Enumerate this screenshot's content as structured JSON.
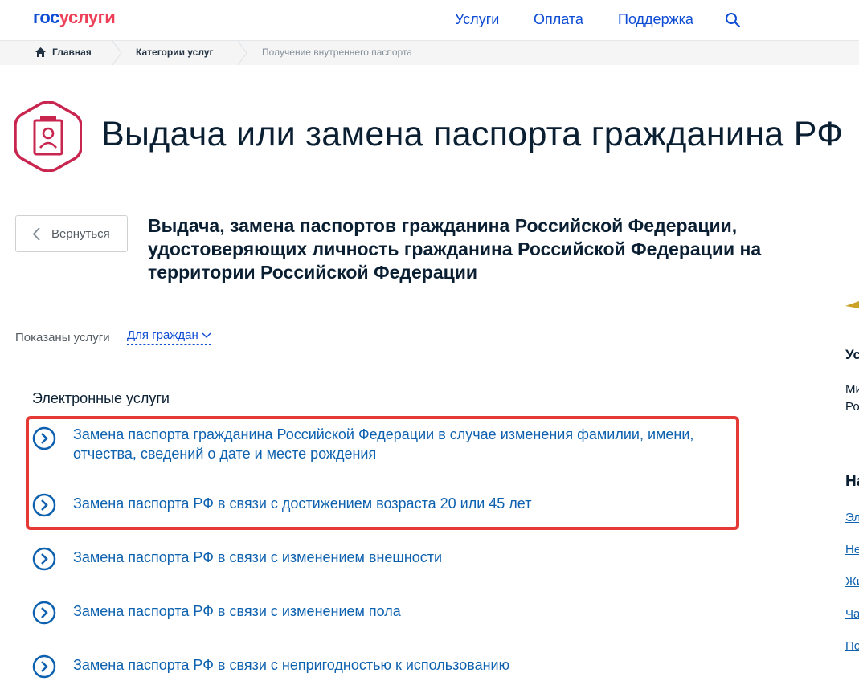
{
  "header": {
    "logo": {
      "part1": "гос",
      "part2": "услуги"
    },
    "nav": [
      {
        "label": "Услуги"
      },
      {
        "label": "Оплата"
      },
      {
        "label": "Поддержка"
      }
    ]
  },
  "breadcrumbs": [
    {
      "label": "Главная"
    },
    {
      "label": "Категории услуг"
    },
    {
      "label": "Получение внутреннего паспорта"
    }
  ],
  "page": {
    "title": "Выдача или замена паспорта гражданина РФ",
    "back_label": "Вернуться",
    "service_title": "Выдача, замена паспортов гражданина Российской Федерации, удостоверяющих личность гражданина Российской Федерации на территории Российской Федерации"
  },
  "filter": {
    "label": "Показаны услуги",
    "selected": "Для граждан"
  },
  "section": {
    "title": "Электронные услуги",
    "items": [
      {
        "label": "Замена паспорта гражданина Российской Федерации в случае изменения фамилии, имени, отчества, сведений о дате и месте рождения"
      },
      {
        "label": "Замена паспорта РФ в связи с достижением возраста 20 или 45 лет"
      },
      {
        "label": "Замена паспорта РФ в связи с изменением внешности"
      },
      {
        "label": "Замена паспорта РФ в связи с изменением пола"
      },
      {
        "label": "Замена паспорта РФ в связи с непригодностью к использованию"
      }
    ]
  },
  "right_fragments": {
    "heading1": "Ус",
    "line1": "Ми",
    "line2": "Ро",
    "heading2": "На",
    "links": [
      "Эл",
      "Не",
      "Жи",
      "Ча",
      "По"
    ]
  },
  "colors": {
    "brand_blue": "#0d4cd3",
    "brand_red": "#ee3f58",
    "link_blue": "#0d61af",
    "highlight_red": "#e53935",
    "icon_crimson": "#c8254f"
  }
}
